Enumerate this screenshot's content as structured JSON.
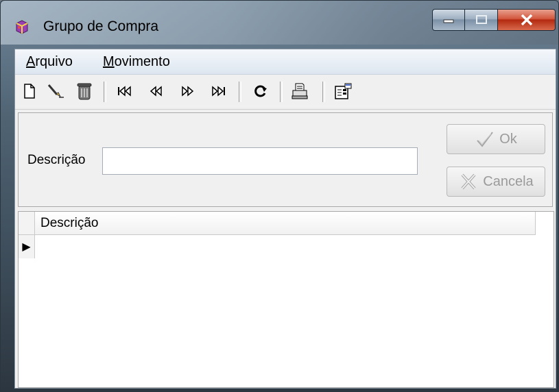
{
  "window": {
    "title": "Grupo de Compra"
  },
  "menu": [
    {
      "accel": "A",
      "rest": "rquivo"
    },
    {
      "accel": "M",
      "rest": "ovimento"
    }
  ],
  "toolbar": {
    "icons": [
      "new-document-icon",
      "edit-icon",
      "delete-icon",
      "first-record-icon",
      "prior-record-icon",
      "next-record-icon",
      "last-record-icon",
      "refresh-icon",
      "print-icon",
      "properties-icon"
    ]
  },
  "form": {
    "description_label": "Descrição",
    "description_value": "",
    "ok_label": "Ok",
    "cancel_label": "Cancela"
  },
  "grid": {
    "columns": [
      "Descrição"
    ],
    "current_row_indicator": "▶",
    "rows": []
  },
  "colors": {
    "client_bg": "#f0f0f0",
    "close_button": "#c6432a",
    "disabled_text": "#9a9a9a"
  }
}
